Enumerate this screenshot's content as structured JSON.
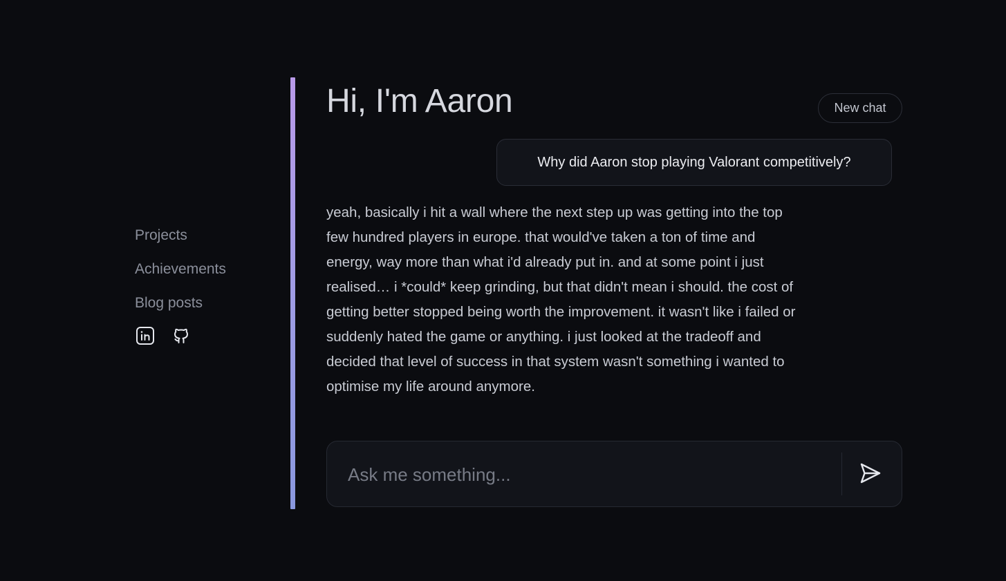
{
  "sidebar": {
    "nav": [
      {
        "label": "Projects"
      },
      {
        "label": "Achievements"
      },
      {
        "label": "Blog posts"
      }
    ],
    "socials": [
      {
        "icon": "linkedin-icon"
      },
      {
        "icon": "github-icon"
      }
    ]
  },
  "header": {
    "title": "Hi, I'm Aaron",
    "new_chat_label": "New chat"
  },
  "conversation": {
    "user_message": "Why did Aaron stop playing Valorant competitively?",
    "assistant_message": "yeah, basically i hit a wall where the next step up was getting into the top few hundred players in europe. that would've taken a ton of time and energy, way more than what i'd already put in. and at some point i just realised… i *could* keep grinding, but that didn't mean i should. the cost of getting better stopped being worth the improvement. it wasn't like i failed or suddenly hated the game or anything. i just looked at the tradeoff and decided that level of success in that system wasn't something i wanted to optimise my life around anymore."
  },
  "composer": {
    "placeholder": "Ask me something...",
    "value": "",
    "send_icon": "send-icon"
  },
  "colors": {
    "background": "#0b0c10",
    "accent_top": "#b89ae8",
    "accent_bottom": "#8a98de"
  }
}
